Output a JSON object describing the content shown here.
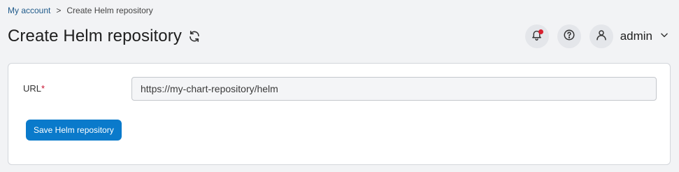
{
  "breadcrumb": {
    "parent": "My account",
    "separator": ">",
    "current": "Create Helm repository"
  },
  "header": {
    "title": "Create Helm repository",
    "refresh_icon": "refresh-icon"
  },
  "topbar": {
    "notifications_icon": "bell-icon",
    "notifications_has_unread": true,
    "help_icon": "help-circle-icon",
    "user_icon": "user-icon",
    "username": "admin",
    "menu_icon": "chevron-down-icon"
  },
  "form": {
    "url_label": "URL",
    "url_required_marker": "*",
    "url_value": "https://my-chart-repository/helm",
    "save_label": "Save Helm repository"
  },
  "colors": {
    "primary": "#0a7acb",
    "required": "#c8102e",
    "notification_dot": "#d8202f",
    "link": "#1f5a8a"
  }
}
